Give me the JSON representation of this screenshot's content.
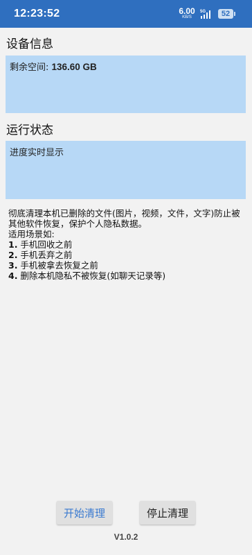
{
  "status_bar": {
    "time": "12:23:52",
    "net_speed_value": "6.00",
    "net_speed_unit": "KB/S",
    "signal_label": "5G",
    "battery": "52",
    "bg_color": "#2f6fbf"
  },
  "device_info": {
    "title": "设备信息",
    "free_space_label": "剩余空间: ",
    "free_space_value": "136.60 GB"
  },
  "run_status": {
    "title": "运行状态",
    "progress_text": "进度实时显示"
  },
  "description": {
    "intro": "彻底清理本机已删除的文件(图片，视频，文件，文字)防止被其他软件恢复，保护个人隐私数据。",
    "scenarios_title": "适用场景如:",
    "scenarios": [
      {
        "num": "1.",
        "text": " 手机回收之前"
      },
      {
        "num": "2.",
        "text": " 手机丢弃之前"
      },
      {
        "num": "3.",
        "text": " 手机被拿去恢复之前"
      },
      {
        "num": "4.",
        "text": " 删除本机隐私不被恢复(如聊天记录等)"
      }
    ]
  },
  "actions": {
    "start_label": "开始清理",
    "stop_label": "停止清理"
  },
  "version": "V1.0.2",
  "colors": {
    "panel_bg": "#b7d8f6",
    "accent": "#3a7ad0"
  }
}
